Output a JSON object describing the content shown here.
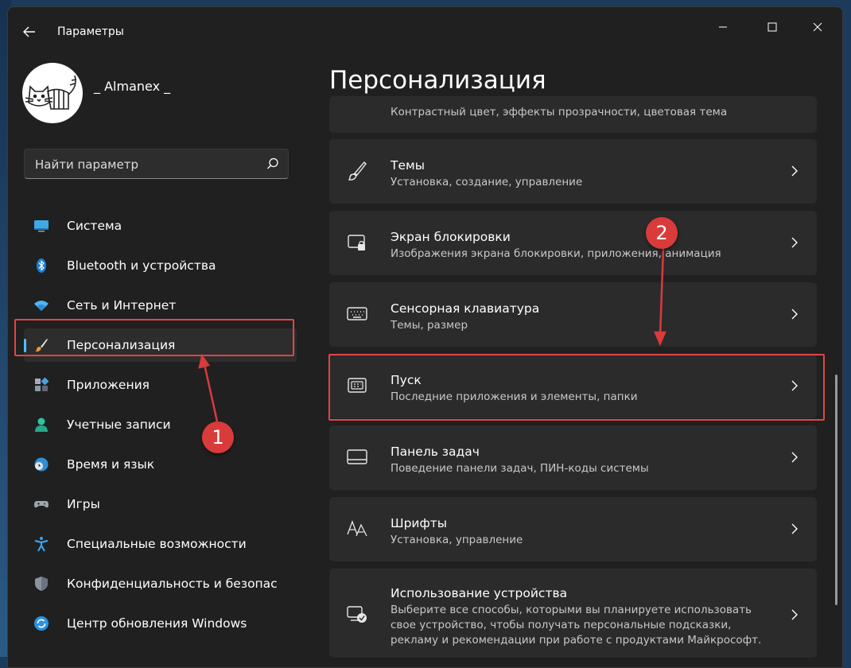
{
  "window": {
    "title": "Параметры",
    "controls": [
      "minimize",
      "maximize",
      "close"
    ]
  },
  "user": {
    "name": "_ Almanex _"
  },
  "search": {
    "placeholder": "Найти параметр"
  },
  "sidebar": {
    "items": [
      {
        "label": "Система",
        "icon": "system-icon"
      },
      {
        "label": "Bluetooth и устройства",
        "icon": "bluetooth-icon"
      },
      {
        "label": "Сеть и Интернет",
        "icon": "wifi-icon"
      },
      {
        "label": "Персонализация",
        "icon": "brush-icon",
        "active": true
      },
      {
        "label": "Приложения",
        "icon": "apps-icon"
      },
      {
        "label": "Учетные записи",
        "icon": "person-icon"
      },
      {
        "label": "Время и язык",
        "icon": "globe-clock-icon"
      },
      {
        "label": "Игры",
        "icon": "gamepad-icon"
      },
      {
        "label": "Специальные возможности",
        "icon": "accessibility-icon"
      },
      {
        "label": "Конфиденциальность и безопас",
        "icon": "shield-icon"
      },
      {
        "label": "Центр обновления Windows",
        "icon": "update-icon"
      }
    ]
  },
  "main": {
    "title": "Персонализация",
    "partial_card_subtitle": "Контрастный цвет, эффекты прозрачности, цветовая тема",
    "cards": [
      {
        "title": "Темы",
        "subtitle": "Установка, создание, управление",
        "icon": "brush-icon"
      },
      {
        "title": "Экран блокировки",
        "subtitle": "Изображения экрана блокировки, приложения, анимация",
        "icon": "lock-screen-icon"
      },
      {
        "title": "Сенсорная клавиатура",
        "subtitle": "Темы, размер",
        "icon": "keyboard-icon"
      },
      {
        "title": "Пуск",
        "subtitle": "Последние приложения и элементы, папки",
        "icon": "start-icon",
        "highlighted": true
      },
      {
        "title": "Панель задач",
        "subtitle": "Поведение панели задач, ПИН-коды системы",
        "icon": "taskbar-icon"
      },
      {
        "title": "Шрифты",
        "subtitle": "Установка, управление",
        "icon": "fonts-icon"
      },
      {
        "title": "Использование устройства",
        "subtitle": "Выберите все способы, которыми вы планируете использовать свое устройство, чтобы получать персональные подсказки, рекламу и рекомендации при работе с продуктами Майкрософт.",
        "icon": "device-usage-icon"
      }
    ]
  },
  "annotations": {
    "badge1": "1",
    "badge2": "2",
    "color": "#d93b3b"
  },
  "colors": {
    "accent": "#4cc2ff",
    "window_bg": "#202020",
    "card_bg": "#2b2b2b"
  }
}
